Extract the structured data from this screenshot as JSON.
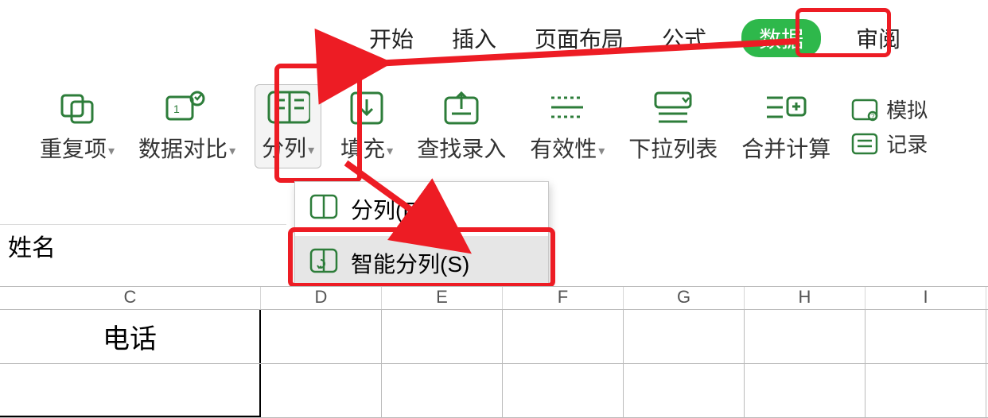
{
  "menu": {
    "start": "开始",
    "insert": "插入",
    "layout": "页面布局",
    "formula": "公式",
    "data": "数据",
    "review": "审阅"
  },
  "ribbon": {
    "dup": "重复项",
    "compare": "数据对比",
    "split": "分列",
    "fill": "填充",
    "find": "查找录入",
    "valid": "有效性",
    "dropdown": "下拉列表",
    "merge": "合并计算",
    "simulate": "模拟",
    "record": "记录"
  },
  "dropdown": {
    "item1": "分列(E)",
    "item2": "智能分列(S)"
  },
  "formula_bar": "姓名",
  "columns": [
    "C",
    "D",
    "E",
    "F",
    "G",
    "H",
    "I"
  ],
  "cell_c1": "电话"
}
